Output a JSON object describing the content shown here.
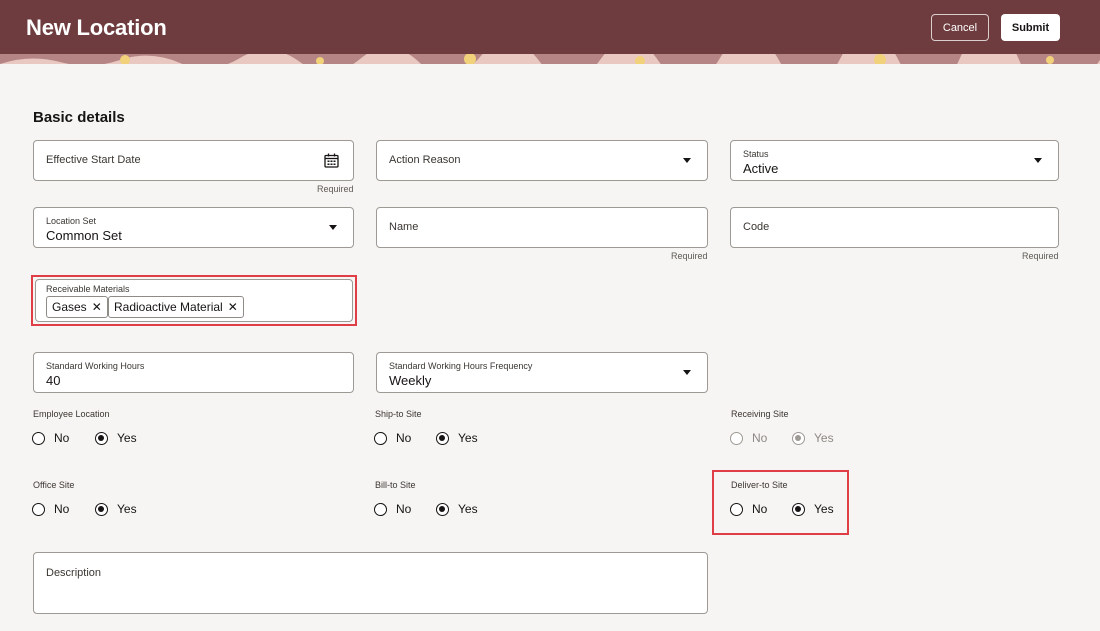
{
  "header": {
    "title": "New Location",
    "cancel_label": "Cancel",
    "submit_label": "Submit",
    "background": "#6e3c3f"
  },
  "section": {
    "title": "Basic details"
  },
  "fields": {
    "effective_start_date": {
      "label": "Effective Start Date",
      "value": "",
      "helper": "Required",
      "icon": "calendar-icon"
    },
    "action_reason": {
      "label": "Action Reason",
      "value": ""
    },
    "status": {
      "label": "Status",
      "value": "Active"
    },
    "location_set": {
      "label": "Location Set",
      "value": "Common Set"
    },
    "name": {
      "label": "Name",
      "value": "",
      "helper": "Required"
    },
    "code": {
      "label": "Code",
      "value": "",
      "helper": "Required"
    },
    "receivable_materials": {
      "label": "Receivable Materials",
      "chips": [
        "Gases",
        "Radioactive Material"
      ]
    },
    "standard_working_hours": {
      "label": "Standard Working Hours",
      "value": "40"
    },
    "standard_working_hours_frequency": {
      "label": "Standard Working Hours Frequency",
      "value": "Weekly"
    },
    "description": {
      "label": "Description",
      "value": ""
    }
  },
  "radio_groups": {
    "employee_location": {
      "label": "Employee Location",
      "options": [
        "No",
        "Yes"
      ],
      "selected": "Yes",
      "disabled": false
    },
    "ship_to_site": {
      "label": "Ship-to Site",
      "options": [
        "No",
        "Yes"
      ],
      "selected": "Yes",
      "disabled": false
    },
    "receiving_site": {
      "label": "Receiving Site",
      "options": [
        "No",
        "Yes"
      ],
      "selected": "Yes",
      "disabled": true
    },
    "office_site": {
      "label": "Office Site",
      "options": [
        "No",
        "Yes"
      ],
      "selected": "Yes",
      "disabled": false
    },
    "bill_to_site": {
      "label": "Bill-to Site",
      "options": [
        "No",
        "Yes"
      ],
      "selected": "Yes",
      "disabled": false
    },
    "deliver_to_site": {
      "label": "Deliver-to Site",
      "options": [
        "No",
        "Yes"
      ],
      "selected": "Yes",
      "disabled": false
    }
  },
  "colors": {
    "highlight": "#e03e46",
    "page_background": "#f7f5f3"
  }
}
